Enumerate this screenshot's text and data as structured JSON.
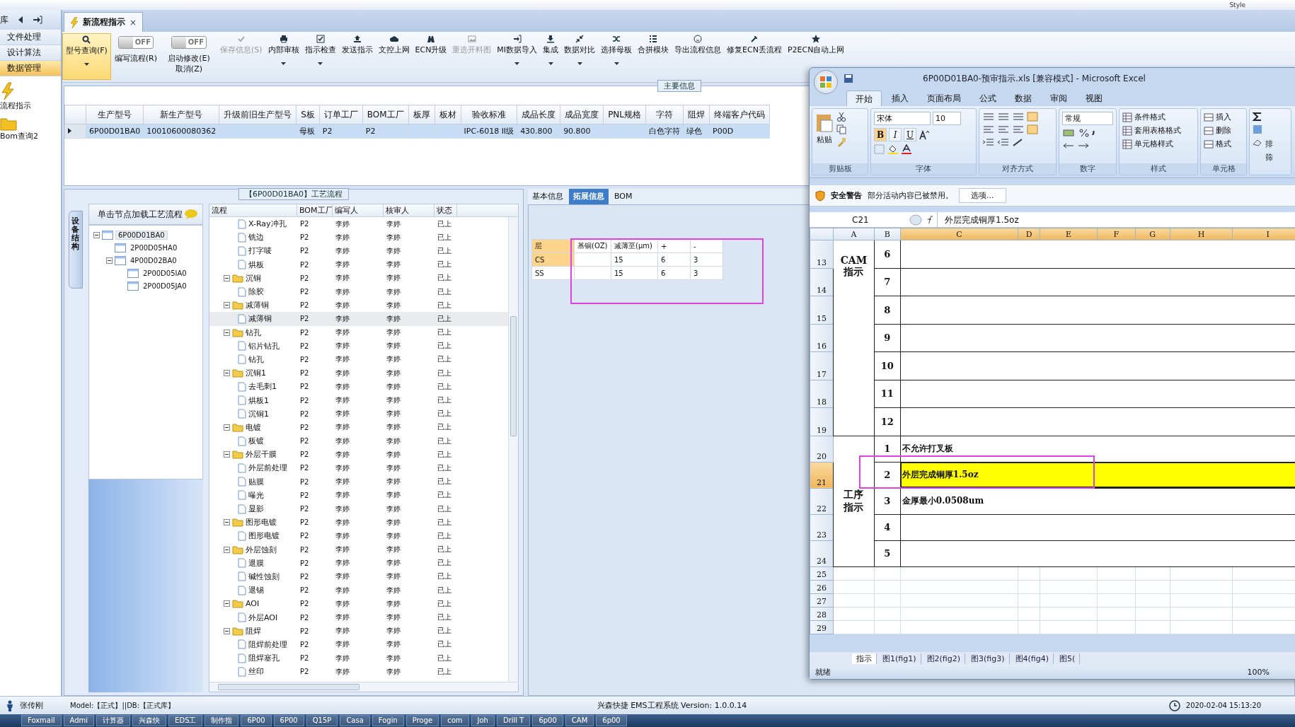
{
  "top_strip": {
    "style_label": "Style"
  },
  "nav": {
    "header": "库",
    "items": [
      {
        "label": "文件处理",
        "selected": false
      },
      {
        "label": "设计算法",
        "selected": false
      },
      {
        "label": "数据管理",
        "selected": true
      }
    ],
    "shortcuts": [
      {
        "label": "流程指示"
      },
      {
        "label": "Bom查询2"
      }
    ]
  },
  "document_tab": {
    "label": "新流程指示",
    "close": "×"
  },
  "toolbar": [
    {
      "kind": "button",
      "label": "型号查询(F)",
      "highlighted": true,
      "disabled": false,
      "dropdown": true
    },
    {
      "kind": "toggle",
      "label": "编写流程(R)",
      "toggle_text": "OFF",
      "on": false
    },
    {
      "kind": "toggle",
      "label": "启动修改(E)",
      "sub_label": "取消(Z)",
      "toggle_text": "OFF",
      "on": false
    },
    {
      "kind": "button",
      "label": "保存信息(S)",
      "highlighted": false,
      "disabled": true,
      "dropdown": false
    },
    {
      "kind": "button",
      "label": "内部审核",
      "highlighted": false,
      "disabled": false,
      "dropdown": true
    },
    {
      "kind": "button",
      "label": "指示检查",
      "highlighted": false,
      "disabled": false,
      "dropdown": true
    },
    {
      "kind": "button",
      "label": "发送指示",
      "highlighted": false,
      "disabled": false,
      "dropdown": false
    },
    {
      "kind": "button",
      "label": "文控上网",
      "highlighted": false,
      "disabled": false,
      "dropdown": false
    },
    {
      "kind": "button",
      "label": "ECN升级",
      "highlighted": false,
      "disabled": false,
      "dropdown": false
    },
    {
      "kind": "button",
      "label": "重选开料图",
      "highlighted": false,
      "disabled": true,
      "dropdown": false
    },
    {
      "kind": "button",
      "label": "MI数据导入",
      "highlighted": false,
      "disabled": false,
      "dropdown": true
    },
    {
      "kind": "button",
      "label": "集成",
      "highlighted": false,
      "disabled": false,
      "dropdown": true
    },
    {
      "kind": "button",
      "label": "数据对比",
      "highlighted": false,
      "disabled": false,
      "dropdown": true
    },
    {
      "kind": "button",
      "label": "选择母板",
      "highlighted": false,
      "disabled": false,
      "dropdown": true
    },
    {
      "kind": "button",
      "label": "合拼模块",
      "highlighted": false,
      "disabled": false,
      "dropdown": false
    },
    {
      "kind": "button",
      "label": "导出流程信息",
      "highlighted": false,
      "disabled": false,
      "dropdown": false
    },
    {
      "kind": "button",
      "label": "修复ECN丢流程",
      "highlighted": false,
      "disabled": false,
      "dropdown": false
    },
    {
      "kind": "button",
      "label": "P2ECN自动上网",
      "highlighted": false,
      "disabled": false,
      "dropdown": false
    }
  ],
  "main_info": {
    "title": "主要信息",
    "columns": [
      "生产型号",
      "新生产型号",
      "升级前旧生产型号",
      "S板",
      "订单工厂",
      "BOM工厂",
      "板厚",
      "板材",
      "验收标准",
      "成品长度",
      "成品宽度",
      "PNL规格",
      "字符",
      "阻焊",
      "终端客户代码"
    ],
    "rows": [
      {
        "selected": true,
        "cells": [
          "6P00D01BA0",
          "10010600080362",
          null,
          "母板",
          "P2",
          "P2",
          null,
          null,
          "IPC-6018 II级",
          "430.800",
          "90.800",
          null,
          "白色字符",
          "绿色",
          "P00D"
        ]
      }
    ]
  },
  "flow_panel": {
    "title": "【6P00D01BA0】工艺流程",
    "side_tab": "设备结构",
    "tree_hint": "单击节点加载工艺流程",
    "tree": [
      {
        "label": "6P00D01BA0",
        "selected": true,
        "expanded": true,
        "children": [
          {
            "label": "2P00D05HA0",
            "selected": false
          },
          {
            "label": "4P00D02BA0",
            "selected": false,
            "expanded": true,
            "children": [
              {
                "label": "2P00D05IA0",
                "selected": false
              },
              {
                "label": "2P00D05JA0",
                "selected": false
              }
            ]
          }
        ]
      }
    ],
    "grid": {
      "columns": [
        "流程",
        "BOM工厂",
        "编写人",
        "核审人",
        "状态"
      ],
      "rows": [
        {
          "kind": "step",
          "name": "X-Ray冲孔",
          "bom": "P2",
          "writer": "李婷",
          "reviewer": "李婷",
          "status": "已上",
          "selected": false
        },
        {
          "kind": "step",
          "name": "铣边",
          "bom": "P2",
          "writer": "李婷",
          "reviewer": "李婷",
          "status": "已上",
          "selected": false
        },
        {
          "kind": "step",
          "name": "打字唛",
          "bom": "P2",
          "writer": "李婷",
          "reviewer": "李婷",
          "status": "已上",
          "selected": false
        },
        {
          "kind": "step",
          "name": "烘板",
          "bom": "P2",
          "writer": "李婷",
          "reviewer": "李婷",
          "status": "已上",
          "selected": false
        },
        {
          "kind": "group",
          "name": "沉铜",
          "bom": "P2",
          "writer": "李婷",
          "reviewer": "李婷",
          "status": "已上",
          "selected": false,
          "expanded": true,
          "children": [
            {
              "kind": "step",
              "name": "除胶",
              "bom": "P2",
              "writer": "李婷",
              "reviewer": "李婷",
              "status": "已上",
              "selected": false
            }
          ]
        },
        {
          "kind": "group",
          "name": "减薄铜",
          "bom": "P2",
          "writer": "李婷",
          "reviewer": "李婷",
          "status": "已上",
          "selected": false,
          "expanded": true,
          "children": [
            {
              "kind": "step",
              "name": "减薄铜",
              "bom": "P2",
              "writer": "李婷",
              "reviewer": "李婷",
              "status": "已上",
              "selected": true
            }
          ]
        },
        {
          "kind": "group",
          "name": "钻孔",
          "bom": "P2",
          "writer": "李婷",
          "reviewer": "李婷",
          "status": "已上",
          "selected": false,
          "expanded": true,
          "children": [
            {
              "kind": "step",
              "name": "铝片钻孔",
              "bom": "P2",
              "writer": "李婷",
              "reviewer": "李婷",
              "status": "已上",
              "selected": false
            },
            {
              "kind": "step",
              "name": "钻孔",
              "bom": "P2",
              "writer": "李婷",
              "reviewer": "李婷",
              "status": "已上",
              "selected": false
            }
          ]
        },
        {
          "kind": "group",
          "name": "沉铜1",
          "bom": "P2",
          "writer": "李婷",
          "reviewer": "李婷",
          "status": "已上",
          "selected": false,
          "expanded": true,
          "children": [
            {
              "kind": "step",
              "name": "去毛刺1",
              "bom": "P2",
              "writer": "李婷",
              "reviewer": "李婷",
              "status": "已上",
              "selected": false
            },
            {
              "kind": "step",
              "name": "烘板1",
              "bom": "P2",
              "writer": "李婷",
              "reviewer": "李婷",
              "status": "已上",
              "selected": false
            },
            {
              "kind": "step",
              "name": "沉铜1",
              "bom": "P2",
              "writer": "李婷",
              "reviewer": "李婷",
              "status": "已上",
              "selected": false
            }
          ]
        },
        {
          "kind": "group",
          "name": "电镀",
          "bom": "P2",
          "writer": "李婷",
          "reviewer": "李婷",
          "status": "已上",
          "selected": false,
          "expanded": true,
          "children": [
            {
              "kind": "step",
              "name": "板镀",
              "bom": "P2",
              "writer": "李婷",
              "reviewer": "李婷",
              "status": "已上",
              "selected": false
            }
          ]
        },
        {
          "kind": "group",
          "name": "外层干膜",
          "bom": "P2",
          "writer": "李婷",
          "reviewer": "李婷",
          "status": "已上",
          "selected": false,
          "expanded": true,
          "children": [
            {
              "kind": "step",
              "name": "外层前处理",
              "bom": "P2",
              "writer": "李婷",
              "reviewer": "李婷",
              "status": "已上",
              "selected": false
            },
            {
              "kind": "step",
              "name": "贴膜",
              "bom": "P2",
              "writer": "李婷",
              "reviewer": "李婷",
              "status": "已上",
              "selected": false
            },
            {
              "kind": "step",
              "name": "曝光",
              "bom": "P2",
              "writer": "李婷",
              "reviewer": "李婷",
              "status": "已上",
              "selected": false
            },
            {
              "kind": "step",
              "name": "显影",
              "bom": "P2",
              "writer": "李婷",
              "reviewer": "李婷",
              "status": "已上",
              "selected": false
            }
          ]
        },
        {
          "kind": "group",
          "name": "图形电镀",
          "bom": "P2",
          "writer": "李婷",
          "reviewer": "李婷",
          "status": "已上",
          "selected": false,
          "expanded": true,
          "children": [
            {
              "kind": "step",
              "name": "图形电镀",
              "bom": "P2",
              "writer": "李婷",
              "reviewer": "李婷",
              "status": "已上",
              "selected": false
            }
          ]
        },
        {
          "kind": "group",
          "name": "外层蚀刻",
          "bom": "P2",
          "writer": "李婷",
          "reviewer": "李婷",
          "status": "已上",
          "selected": false,
          "expanded": true,
          "children": [
            {
              "kind": "step",
              "name": "退膜",
              "bom": "P2",
              "writer": "李婷",
              "reviewer": "李婷",
              "status": "已上",
              "selected": false
            },
            {
              "kind": "step",
              "name": "碱性蚀刻",
              "bom": "P2",
              "writer": "李婷",
              "reviewer": "李婷",
              "status": "已上",
              "selected": false
            },
            {
              "kind": "step",
              "name": "退锡",
              "bom": "P2",
              "writer": "李婷",
              "reviewer": "李婷",
              "status": "已上",
              "selected": false
            }
          ]
        },
        {
          "kind": "group",
          "name": "AOI",
          "bom": "P2",
          "writer": "李婷",
          "reviewer": "李婷",
          "status": "已上",
          "selected": false,
          "expanded": true,
          "children": [
            {
              "kind": "step",
              "name": "外层AOI",
              "bom": "P2",
              "writer": "李婷",
              "reviewer": "李婷",
              "status": "已上",
              "selected": false
            }
          ]
        },
        {
          "kind": "group",
          "name": "阻焊",
          "bom": "P2",
          "writer": "李婷",
          "reviewer": "李婷",
          "status": "已上",
          "selected": false,
          "expanded": true,
          "children": [
            {
              "kind": "step",
              "name": "阻焊前处理",
              "bom": "P2",
              "writer": "李婷",
              "reviewer": "李婷",
              "status": "已上",
              "selected": false
            },
            {
              "kind": "step",
              "name": "阻焊塞孔",
              "bom": "P2",
              "writer": "李婷",
              "reviewer": "李婷",
              "status": "已上",
              "selected": false
            },
            {
              "kind": "step",
              "name": "丝印",
              "bom": "P2",
              "writer": "李婷",
              "reviewer": "李婷",
              "status": "已上",
              "selected": false
            }
          ]
        }
      ]
    }
  },
  "detail": {
    "tabs": [
      {
        "label": "基本信息",
        "selected": false
      },
      {
        "label": "拓展信息",
        "selected": true
      },
      {
        "label": "BOM",
        "selected": false
      }
    ],
    "table": {
      "columns": [
        "层",
        "基铜(OZ)",
        "减薄至(μm)",
        "+",
        "-"
      ],
      "rows": [
        {
          "layer": "CS",
          "thin_to": "15",
          "plus": "6",
          "minus": "3",
          "selected": true
        },
        {
          "layer": "SS",
          "thin_to": "15",
          "plus": "6",
          "minus": "3",
          "selected": false
        }
      ]
    }
  },
  "excel": {
    "title": "6P00D01BA0-预审指示.xls  [兼容模式] - Microsoft Excel",
    "ribbon_tabs": [
      {
        "label": "开始",
        "selected": true
      },
      {
        "label": "插入",
        "selected": false
      },
      {
        "label": "页面布局",
        "selected": false
      },
      {
        "label": "公式",
        "selected": false
      },
      {
        "label": "数据",
        "selected": false
      },
      {
        "label": "审阅",
        "selected": false
      },
      {
        "label": "视图",
        "selected": false
      }
    ],
    "paste": "粘贴",
    "font": "宋体",
    "font_size": "10",
    "format_buttons": [
      {
        "label": "B",
        "on": true
      },
      {
        "label": "I",
        "on": false
      },
      {
        "label": "U",
        "on": false
      }
    ],
    "number_format": "常规",
    "style_buttons": [
      "条件格式",
      "套用表格格式",
      "单元格样式"
    ],
    "cell_buttons": [
      "插入",
      "删除",
      "格式"
    ],
    "edit_partial": [
      "排",
      "筛"
    ],
    "groups": [
      "剪贴板",
      "字体",
      "对齐方式",
      "数字",
      "样式",
      "单元格"
    ],
    "security": {
      "title": "安全警告",
      "message": "部分活动内容已被禁用。",
      "button": "选项..."
    },
    "name_box": "C21",
    "formula": "外层完成铜厚1.5oz",
    "columns": [
      {
        "label": "A",
        "selected": false
      },
      {
        "label": "B",
        "selected": false
      },
      {
        "label": "C",
        "selected": true
      },
      {
        "label": "D",
        "selected": true
      },
      {
        "label": "E",
        "selected": true
      },
      {
        "label": "F",
        "selected": true
      },
      {
        "label": "G",
        "selected": true
      },
      {
        "label": "H",
        "selected": true
      },
      {
        "label": "I",
        "selected": true
      }
    ],
    "sections": [
      {
        "label": [
          "CAM",
          "指示"
        ],
        "rows": [
          {
            "row": "13",
            "no": "6",
            "selected": false,
            "filled": false
          },
          {
            "row": "14",
            "no": "7",
            "selected": false,
            "filled": false
          },
          {
            "row": "15",
            "no": "8",
            "selected": false,
            "filled": false
          },
          {
            "row": "16",
            "no": "9",
            "selected": false,
            "filled": false
          },
          {
            "row": "17",
            "no": "10",
            "selected": false,
            "filled": false
          },
          {
            "row": "18",
            "no": "11",
            "selected": false,
            "filled": false
          },
          {
            "row": "19",
            "no": "12",
            "selected": false,
            "filled": false
          }
        ]
      },
      {
        "label": [
          "工序",
          "指示"
        ],
        "rows": [
          {
            "row": "20",
            "no": "1",
            "text": "不允许打叉板",
            "selected": false,
            "filled": false
          },
          {
            "row": "21",
            "no": "2",
            "text": "外层完成铜厚1.5oz",
            "selected": true,
            "filled": true
          },
          {
            "row": "22",
            "no": "3",
            "text": "金厚最小0.0508um",
            "selected": false,
            "filled": false
          },
          {
            "row": "23",
            "no": "4",
            "selected": false,
            "filled": false
          },
          {
            "row": "24",
            "no": "5",
            "selected": false,
            "filled": false
          }
        ]
      }
    ],
    "blank_rows": [
      "25",
      "26",
      "27",
      "28",
      "29"
    ],
    "sheet_tabs": [
      {
        "label": "指示",
        "selected": true
      },
      {
        "label": "图1(fig1)",
        "selected": false
      },
      {
        "label": "图2(fig2)",
        "selected": false
      },
      {
        "label": "图3(fig3)",
        "selected": false
      },
      {
        "label": "图4(fig4)",
        "selected": false
      },
      {
        "label": "图5(",
        "selected": false
      }
    ],
    "status": "就绪",
    "zoom": "100%"
  },
  "status_bar": {
    "user": "张传刚",
    "db": "Model:【正式】||DB:【正式库】",
    "version": "兴森快捷 EMS工程系统 Version: 1.0.0.14",
    "datetime": "2020-02-04 15:13:20"
  },
  "taskbar": [
    "Foxmail",
    "Admi",
    "计算器",
    "兴森快",
    "EDS工",
    "制作指",
    "6P00",
    "6P00",
    "Q15P",
    "Casa",
    "Fogin",
    "Proge",
    "com",
    "Joh",
    "Drill T",
    "6p00",
    "CAM",
    "6p00"
  ]
}
